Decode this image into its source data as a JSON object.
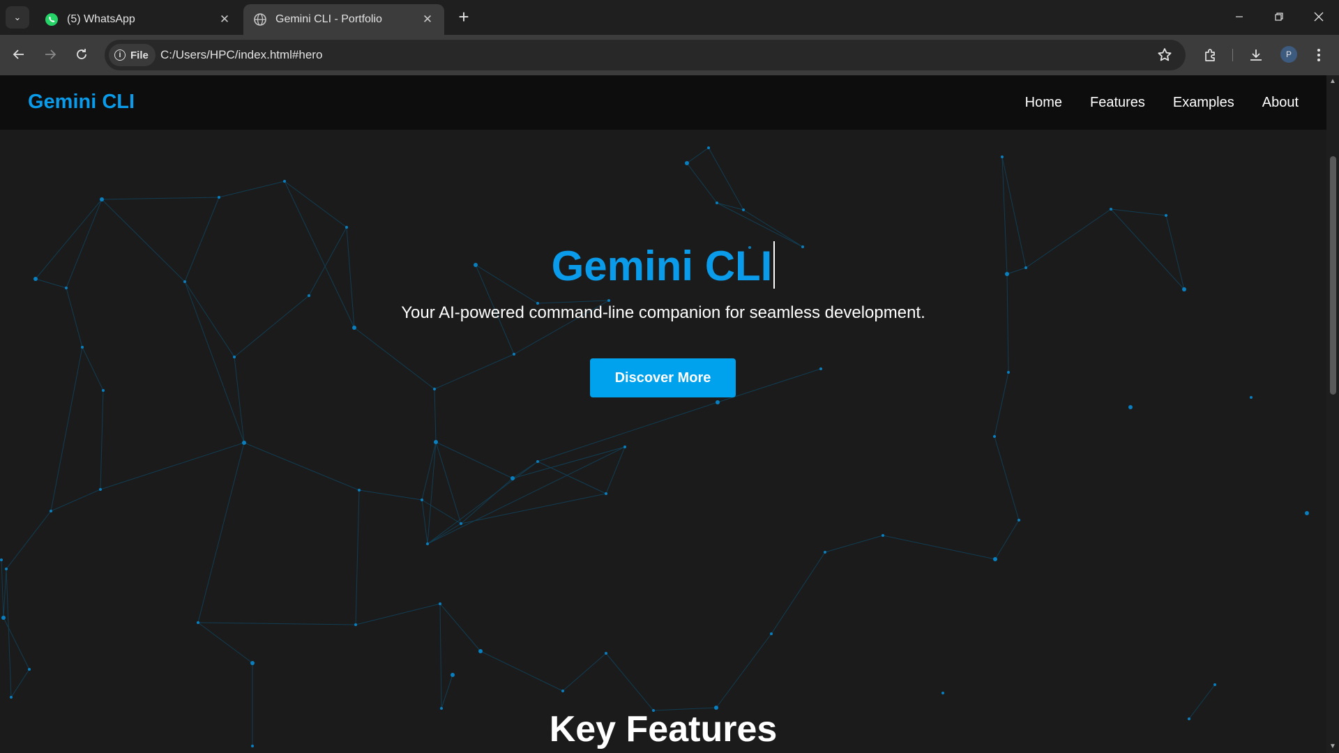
{
  "browser": {
    "tabs": [
      {
        "title": "(5) WhatsApp",
        "icon": "whatsapp-icon",
        "active": false
      },
      {
        "title": "Gemini CLI - Portfolio",
        "icon": "globe-icon",
        "active": true
      }
    ],
    "address": {
      "scheme_chip": "File",
      "url": "C:/Users/HPC/index.html#hero"
    },
    "profile_initial": "P"
  },
  "site": {
    "brand": "Gemini CLI",
    "nav": [
      "Home",
      "Features",
      "Examples",
      "About"
    ],
    "hero": {
      "title": "Gemini CLI",
      "subtitle": "Your AI-powered command-line companion for seamless development.",
      "cta": "Discover More"
    },
    "section_title": "Key Features"
  },
  "colors": {
    "accent": "#0a9bea",
    "button": "#00a2ee",
    "background": "#1b1b1b",
    "navbar": "#0d0d0d"
  }
}
